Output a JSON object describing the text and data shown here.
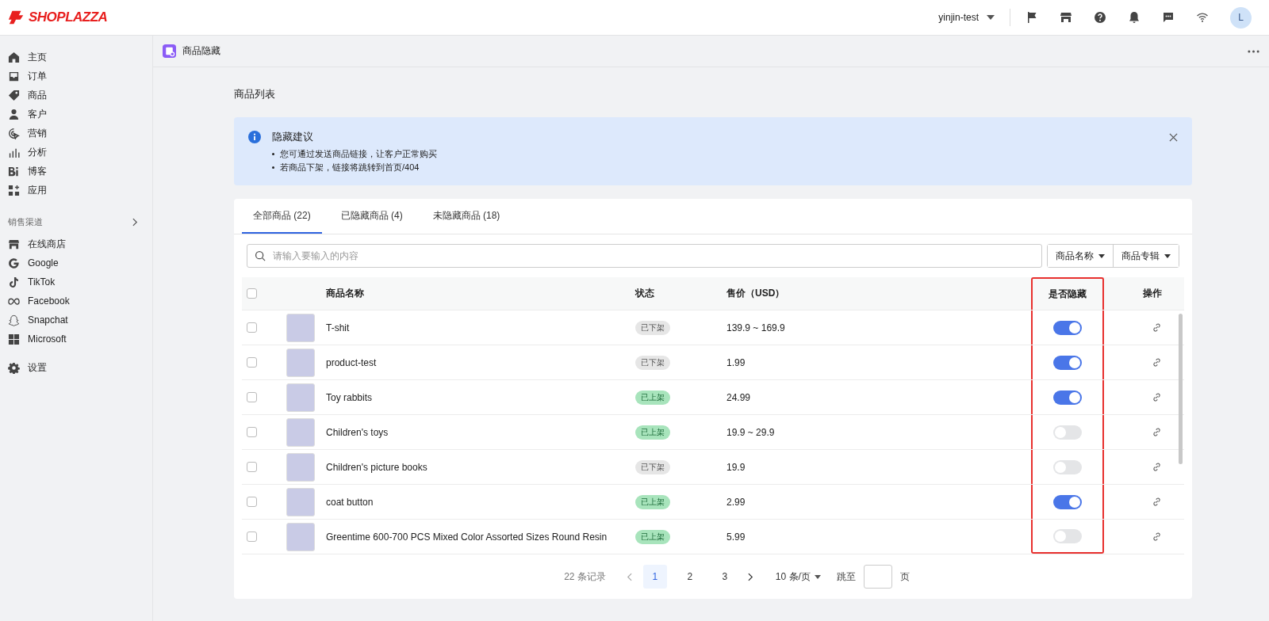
{
  "topbar": {
    "logo": "SHOPLAZZA",
    "store": "yinjin-test",
    "avatar": "L"
  },
  "sidebar": {
    "items": [
      {
        "label": "主页",
        "kind": "home"
      },
      {
        "label": "订单",
        "kind": "inbox"
      },
      {
        "label": "商品",
        "kind": "tag"
      },
      {
        "label": "客户",
        "kind": "person"
      },
      {
        "label": "营销",
        "kind": "marketing"
      },
      {
        "label": "分析",
        "kind": "bars"
      },
      {
        "label": "博客",
        "kind": "blog"
      },
      {
        "label": "应用",
        "kind": "apps"
      }
    ],
    "section_title": "销售渠道",
    "channels": [
      {
        "label": "在线商店",
        "kind": "store"
      },
      {
        "label": "Google",
        "kind": "google"
      },
      {
        "label": "TikTok",
        "kind": "note"
      },
      {
        "label": "Facebook",
        "kind": "infinity"
      },
      {
        "label": "Snapchat",
        "kind": "ghost"
      },
      {
        "label": "Microsoft",
        "kind": "grid"
      }
    ],
    "settings": {
      "label": "设置"
    }
  },
  "breadcrumb": {
    "title": "商品隐藏"
  },
  "page_title": "商品列表",
  "notice": {
    "title": "隐藏建议",
    "bullets": [
      "您可通过发送商品链接，让客户正常购买",
      "若商品下架，链接将跳转到首页/404"
    ]
  },
  "tabs": [
    {
      "label": "全部商品 (22)",
      "selected": true
    },
    {
      "label": "已隐藏商品 (4)",
      "selected": false
    },
    {
      "label": "未隐藏商品 (18)",
      "selected": false
    }
  ],
  "search": {
    "placeholder": "请输入要输入的内容"
  },
  "filters": [
    "商品名称",
    "商品专辑"
  ],
  "table": {
    "columns": [
      {
        "label": "商品名称",
        "highlighted": false
      },
      {
        "label": "状态",
        "highlighted": false
      },
      {
        "label": "售价（USD）",
        "highlighted": false
      },
      {
        "label": "是否隐藏",
        "highlighted": true
      },
      {
        "label": "操作",
        "highlighted": false
      }
    ],
    "header_checked": false,
    "rows": [
      {
        "name": "T-shit",
        "status": "已下架",
        "listed": false,
        "price": "139.9 ~ 169.9",
        "hidden": true,
        "checked": false
      },
      {
        "name": "product-test",
        "status": "已下架",
        "listed": false,
        "price": "1.99",
        "hidden": true,
        "checked": false
      },
      {
        "name": "Toy rabbits",
        "status": "已上架",
        "listed": true,
        "price": "24.99",
        "hidden": true,
        "checked": false
      },
      {
        "name": "Children's toys",
        "status": "已上架",
        "listed": true,
        "price": "19.9 ~ 29.9",
        "hidden": false,
        "checked": false
      },
      {
        "name": "Children's picture books",
        "status": "已下架",
        "listed": false,
        "price": "19.9",
        "hidden": false,
        "checked": false
      },
      {
        "name": "coat button",
        "status": "已上架",
        "listed": true,
        "price": "2.99",
        "hidden": true,
        "checked": false
      },
      {
        "name": "Greentime 600-700 PCS Mixed Color Assorted Sizes Round Resin",
        "status": "已上架",
        "listed": true,
        "price": "5.99",
        "hidden": false,
        "checked": false
      }
    ]
  },
  "pagination": {
    "total": "22 条记录",
    "pages": [
      {
        "label": "1",
        "selected": true
      },
      {
        "label": "2",
        "selected": false
      },
      {
        "label": "3",
        "selected": false
      }
    ],
    "page_size": "10 条/页",
    "jump_label": "跳至",
    "jump_suffix": "页"
  }
}
